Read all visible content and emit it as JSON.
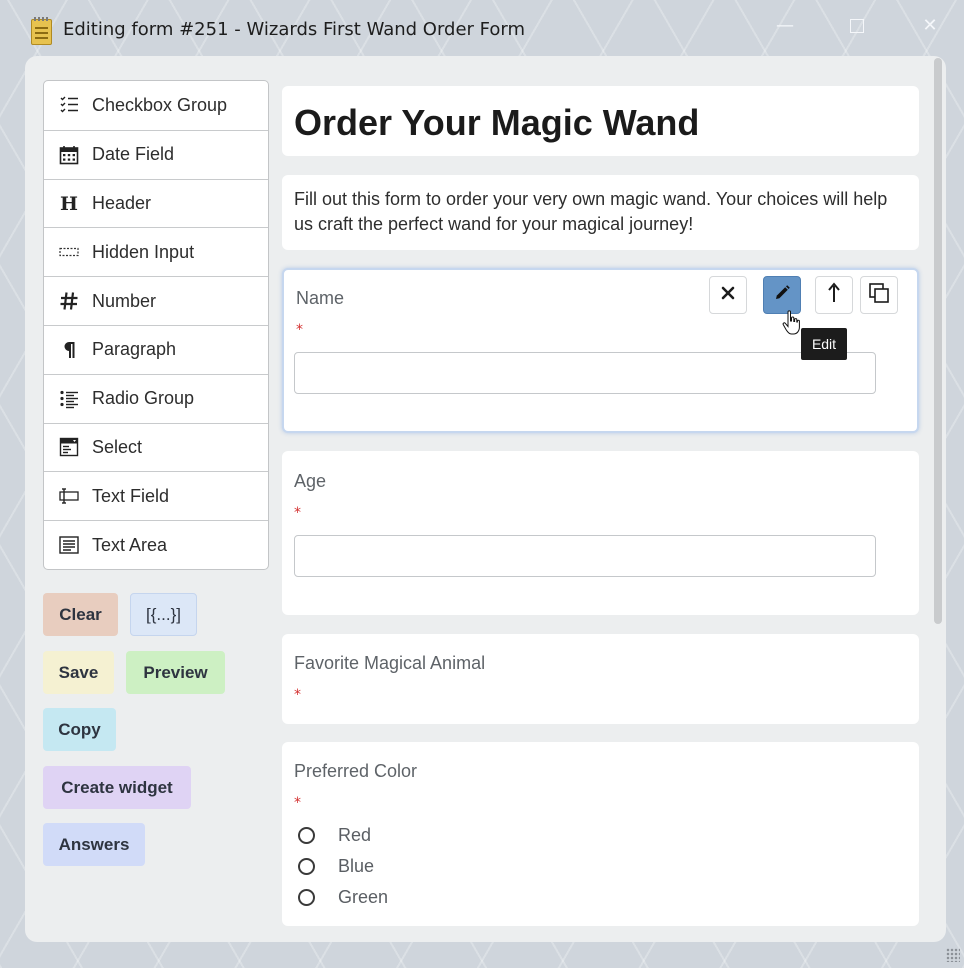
{
  "window": {
    "title": "Editing form #251 - Wizards First Wand Order Form",
    "controls": {
      "minimize": "—",
      "close": "✕"
    }
  },
  "controls_panel": {
    "items": [
      {
        "label": "Checkbox Group",
        "icon": "checkbox-group-icon"
      },
      {
        "label": "Date Field",
        "icon": "calendar-icon"
      },
      {
        "label": "Header",
        "icon": "header-icon"
      },
      {
        "label": "Hidden Input",
        "icon": "hidden-input-icon"
      },
      {
        "label": "Number",
        "icon": "number-icon"
      },
      {
        "label": "Paragraph",
        "icon": "paragraph-icon"
      },
      {
        "label": "Radio Group",
        "icon": "radio-group-icon"
      },
      {
        "label": "Select",
        "icon": "select-icon"
      },
      {
        "label": "Text Field",
        "icon": "text-field-icon"
      },
      {
        "label": "Text Area",
        "icon": "text-area-icon"
      }
    ]
  },
  "actions": {
    "clear": "Clear",
    "json": "[{...}]",
    "save": "Save",
    "preview": "Preview",
    "copy": "Copy",
    "create_widget": "Create widget",
    "answers": "Answers"
  },
  "form": {
    "heading": "Order Your Magic Wand",
    "description": "Fill out this form to order your very own magic wand. Your choices will help us craft the perfect wand for your magical journey!",
    "fields": {
      "name": {
        "label": "Name",
        "required_mark": "*",
        "value": ""
      },
      "age": {
        "label": "Age",
        "required_mark": "*",
        "value": ""
      },
      "animal": {
        "label": "Favorite Magical Animal",
        "required_mark": "*"
      },
      "color": {
        "label": "Preferred Color",
        "required_mark": "*",
        "options": [
          "Red",
          "Blue",
          "Green"
        ]
      }
    }
  },
  "field_toolbar": {
    "delete_icon": "close-icon",
    "edit_icon": "pencil-icon",
    "move_up_icon": "arrow-up-icon",
    "duplicate_icon": "copy-icon",
    "tooltip": "Edit"
  },
  "colors": {
    "edit_button": "#6494c6",
    "required": "#d32f2f",
    "panel_bg": "#eceeef",
    "selected_field_border": "#c6d7ef"
  }
}
